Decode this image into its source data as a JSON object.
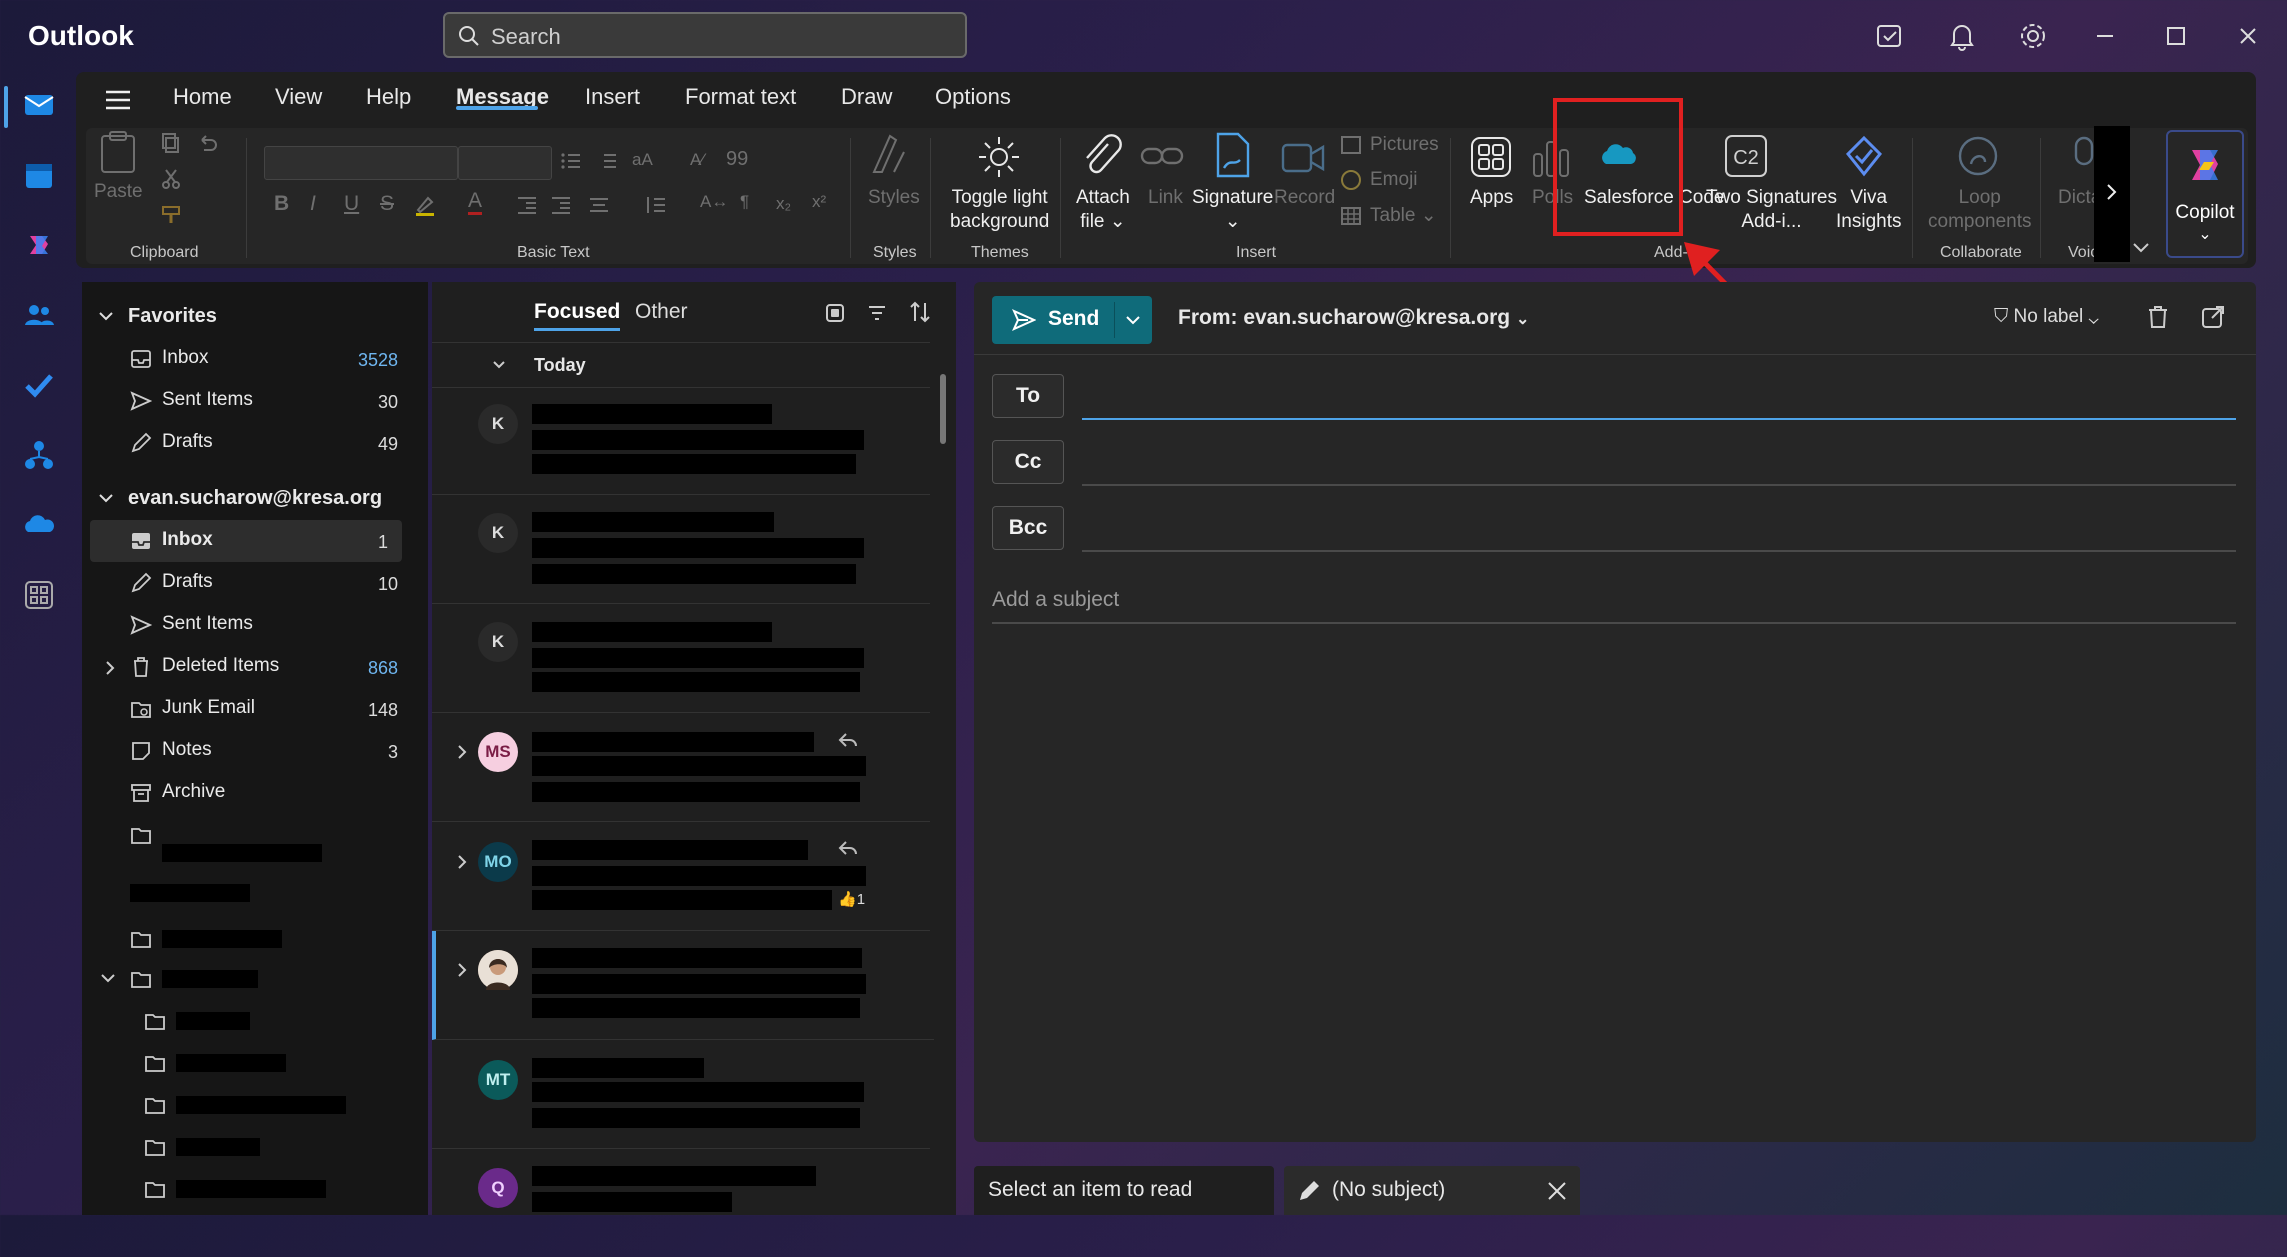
{
  "app": {
    "title": "Outlook",
    "search_placeholder": "Search"
  },
  "ribbon": {
    "tabs": [
      "Home",
      "View",
      "Help",
      "Message",
      "Insert",
      "Format text",
      "Draw",
      "Options"
    ],
    "active_tab": "Message",
    "buttons": {
      "paste": "Paste",
      "styles": "Styles",
      "toggle_light_1": "Toggle light",
      "toggle_light_2": "background",
      "attach_1": "Attach",
      "attach_2": "file",
      "link": "Link",
      "signature": "Signature",
      "record": "Record",
      "pictures": "Pictures",
      "emoji": "Emoji",
      "table": "Table",
      "apps": "Apps",
      "polls": "Polls",
      "salesforce": "Salesforce Code",
      "two_sig_1": "Two Signatures",
      "two_sig_2": "Add-i...",
      "viva_1": "Viva",
      "viva_2": "Insights",
      "loop_1": "Loop",
      "loop_2": "components",
      "dictate": "Dicta",
      "copilot": "Copilot"
    },
    "groups": {
      "clipboard": "Clipboard",
      "basic_text": "Basic Text",
      "styles": "Styles",
      "themes": "Themes",
      "insert": "Insert",
      "addins": "Add-ins",
      "collaborate": "Collaborate",
      "voice": "Voic"
    }
  },
  "folders": {
    "favorites_header": "Favorites",
    "favorites": [
      {
        "label": "Inbox",
        "count": "3528"
      },
      {
        "label": "Sent Items",
        "count": "30"
      },
      {
        "label": "Drafts",
        "count": "49"
      }
    ],
    "account_header": "evan.sucharow@kresa.org",
    "account": [
      {
        "label": "Inbox",
        "count": "1"
      },
      {
        "label": "Drafts",
        "count": "10"
      },
      {
        "label": "Sent Items",
        "count": ""
      },
      {
        "label": "Deleted Items",
        "count": "868"
      },
      {
        "label": "Junk Email",
        "count": "148"
      },
      {
        "label": "Notes",
        "count": "3"
      },
      {
        "label": "Archive",
        "count": ""
      }
    ]
  },
  "message_list": {
    "tab_focused": "Focused",
    "tab_other": "Other",
    "group_today": "Today",
    "avatars": [
      "K",
      "K",
      "K",
      "MS",
      "MO",
      "",
      "MT",
      "Q"
    ],
    "reaction": "1"
  },
  "compose": {
    "send": "Send",
    "from": "From: evan.sucharow@kresa.org",
    "label": "No label",
    "to": "To",
    "cc": "Cc",
    "bcc": "Bcc",
    "subject_placeholder": "Add a subject"
  },
  "bottom": {
    "select_item": "Select an item to read",
    "no_subject": "(No subject)"
  },
  "colors": {
    "accent": "#4ea3e8",
    "send": "#0f6b7a",
    "highlight": "#e02020"
  }
}
